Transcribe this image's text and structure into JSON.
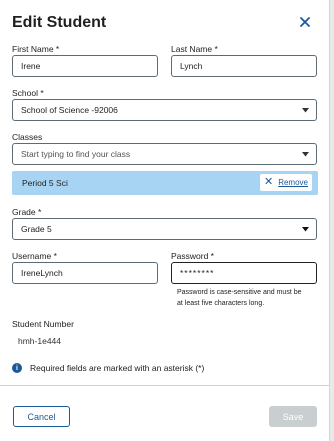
{
  "dialog": {
    "title": "Edit Student"
  },
  "first_name": {
    "label": "First Name *",
    "value": "Irene"
  },
  "last_name": {
    "label": "Last Name *",
    "value": "Lynch"
  },
  "school": {
    "label": "School *",
    "value": "School of Science -92006"
  },
  "classes": {
    "label": "Classes",
    "placeholder": "Start typing to find your class",
    "selected": [
      {
        "name": "Period 5 Sci",
        "remove_label": "Remove"
      }
    ]
  },
  "grade": {
    "label": "Grade *",
    "value": "Grade 5"
  },
  "username": {
    "label": "Username *",
    "value": "IreneLynch"
  },
  "password": {
    "label": "Password *",
    "value": "********",
    "help_line1": "Password is case-sensitive and must be",
    "help_line2": "at least five characters long."
  },
  "student_number": {
    "label": "Student Number",
    "value": "hmh-1e444"
  },
  "info": {
    "text": "Required fields are marked with an asterisk (*)"
  },
  "actions": {
    "cancel_label": "Cancel",
    "save_label": "Save"
  },
  "colors": {
    "accent": "#1b5a98",
    "chip_bg": "#a8d4f4",
    "disabled": "#c9ced1"
  }
}
